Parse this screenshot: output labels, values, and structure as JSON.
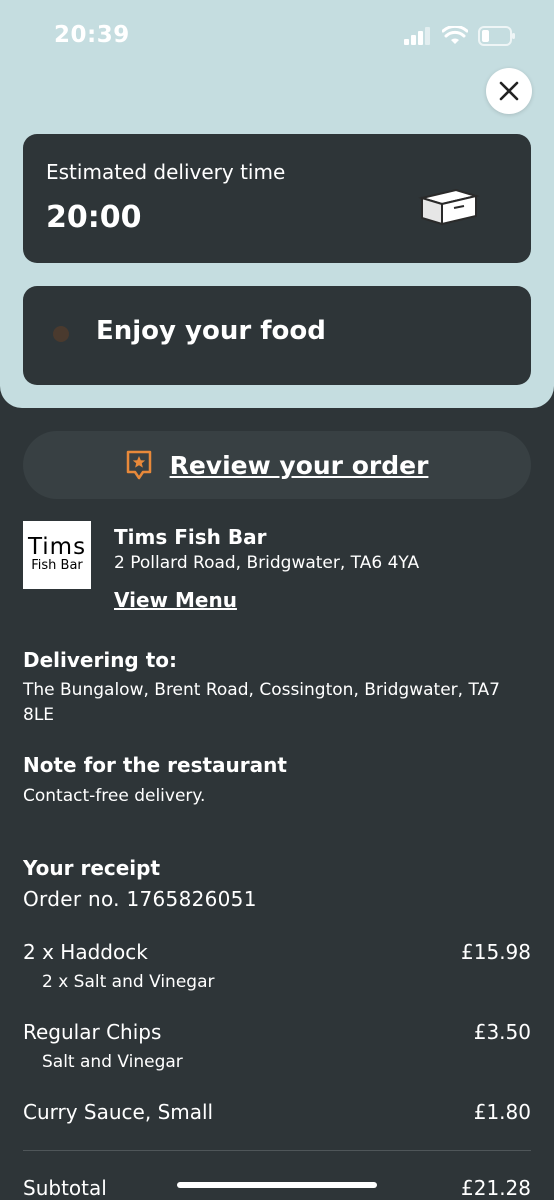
{
  "status_bar": {
    "time": "20:39"
  },
  "delivery": {
    "label": "Estimated delivery time",
    "time": "20:00"
  },
  "status_message": "Enjoy your food",
  "review": {
    "label": "Review your order"
  },
  "restaurant": {
    "logo_line1": "Tims",
    "logo_line2": "Fish Bar",
    "name": "Tims Fish Bar",
    "address": "2 Pollard Road, Bridgwater, TA6 4YA",
    "view_menu": "View Menu"
  },
  "delivering_to": {
    "title": "Delivering to:",
    "address": "The Bungalow, Brent Road, Cossington, Bridgwater, TA7 8LE"
  },
  "note": {
    "title": "Note for the restaurant",
    "text": "Contact-free delivery."
  },
  "receipt": {
    "title": "Your receipt",
    "order_no": "Order no.  1765826051",
    "items": [
      {
        "name": "2 x Haddock",
        "option": "2 x Salt and Vinegar",
        "price": "£15.98"
      },
      {
        "name": "Regular Chips",
        "option": "Salt and Vinegar",
        "price": "£3.50"
      },
      {
        "name": "Curry Sauce, Small",
        "option": "",
        "price": "£1.80"
      }
    ],
    "subtotal_label": "Subtotal",
    "subtotal_value": "£21.28"
  },
  "colors": {
    "top_panel": "#c5dde0",
    "card": "#2e3538",
    "accent": "#e8893a"
  },
  "icons": {
    "close": "close-icon",
    "review": "star-badge-icon",
    "box": "box-icon"
  }
}
